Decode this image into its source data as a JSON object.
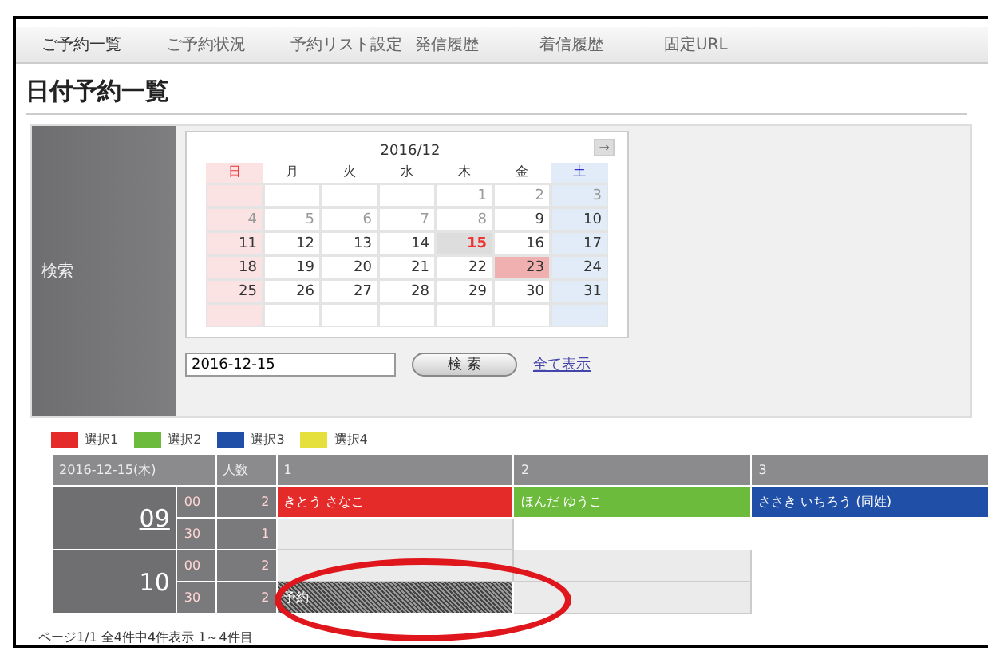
{
  "nav": [
    {
      "label": "ご予約一覧",
      "selected": true
    },
    {
      "label": "ご予約状況",
      "selected": false
    },
    {
      "label": "予約リスト設定",
      "selected": false
    },
    {
      "label": "発信履歴",
      "selected": false
    },
    {
      "label": "着信履歴",
      "selected": false
    },
    {
      "label": "固定URL",
      "selected": false
    }
  ],
  "page_title": "日付予約一覧",
  "search": {
    "label": "検索",
    "calendar": {
      "month": "2016/12",
      "next": "→",
      "weekdays": [
        "日",
        "月",
        "火",
        "水",
        "木",
        "金",
        "土"
      ],
      "cells": [
        {
          "kind": "empty"
        },
        {
          "kind": "empty"
        },
        {
          "kind": "empty"
        },
        {
          "kind": "empty"
        },
        {
          "kind": "day",
          "day": "1",
          "disabled": true,
          "today": false,
          "selected": false
        },
        {
          "kind": "day",
          "day": "2",
          "disabled": true,
          "today": false,
          "selected": false
        },
        {
          "kind": "day",
          "day": "3",
          "disabled": true,
          "today": false,
          "selected": false
        },
        {
          "kind": "day",
          "day": "4",
          "disabled": true,
          "today": false,
          "selected": false
        },
        {
          "kind": "day",
          "day": "5",
          "disabled": true,
          "today": false,
          "selected": false
        },
        {
          "kind": "day",
          "day": "6",
          "disabled": true,
          "today": false,
          "selected": false
        },
        {
          "kind": "day",
          "day": "7",
          "disabled": true,
          "today": false,
          "selected": false
        },
        {
          "kind": "day",
          "day": "8",
          "disabled": true,
          "today": false,
          "selected": false
        },
        {
          "kind": "day",
          "day": "9",
          "disabled": false,
          "today": false,
          "selected": false
        },
        {
          "kind": "day",
          "day": "10",
          "disabled": false,
          "today": false,
          "selected": false
        },
        {
          "kind": "day",
          "day": "11",
          "disabled": false,
          "today": false,
          "selected": false
        },
        {
          "kind": "day",
          "day": "12",
          "disabled": false,
          "today": false,
          "selected": false
        },
        {
          "kind": "day",
          "day": "13",
          "disabled": false,
          "today": false,
          "selected": false
        },
        {
          "kind": "day",
          "day": "14",
          "disabled": false,
          "today": false,
          "selected": false
        },
        {
          "kind": "day",
          "day": "15",
          "disabled": false,
          "today": true,
          "selected": false
        },
        {
          "kind": "day",
          "day": "16",
          "disabled": false,
          "today": false,
          "selected": false
        },
        {
          "kind": "day",
          "day": "17",
          "disabled": false,
          "today": false,
          "selected": false
        },
        {
          "kind": "day",
          "day": "18",
          "disabled": false,
          "today": false,
          "selected": false
        },
        {
          "kind": "day",
          "day": "19",
          "disabled": false,
          "today": false,
          "selected": false
        },
        {
          "kind": "day",
          "day": "20",
          "disabled": false,
          "today": false,
          "selected": false
        },
        {
          "kind": "day",
          "day": "21",
          "disabled": false,
          "today": false,
          "selected": false
        },
        {
          "kind": "day",
          "day": "22",
          "disabled": false,
          "today": false,
          "selected": false
        },
        {
          "kind": "day",
          "day": "23",
          "disabled": false,
          "today": false,
          "selected": true
        },
        {
          "kind": "day",
          "day": "24",
          "disabled": false,
          "today": false,
          "selected": false
        },
        {
          "kind": "day",
          "day": "25",
          "disabled": false,
          "today": false,
          "selected": false
        },
        {
          "kind": "day",
          "day": "26",
          "disabled": false,
          "today": false,
          "selected": false
        },
        {
          "kind": "day",
          "day": "27",
          "disabled": false,
          "today": false,
          "selected": false
        },
        {
          "kind": "day",
          "day": "28",
          "disabled": false,
          "today": false,
          "selected": false
        },
        {
          "kind": "day",
          "day": "29",
          "disabled": false,
          "today": false,
          "selected": false
        },
        {
          "kind": "day",
          "day": "30",
          "disabled": false,
          "today": false,
          "selected": false
        },
        {
          "kind": "day",
          "day": "31",
          "disabled": false,
          "today": false,
          "selected": false
        },
        {
          "kind": "empty"
        },
        {
          "kind": "empty"
        },
        {
          "kind": "empty"
        },
        {
          "kind": "empty"
        },
        {
          "kind": "empty"
        },
        {
          "kind": "empty"
        },
        {
          "kind": "empty"
        }
      ]
    },
    "date_value": "2016-12-15",
    "button": "検 索",
    "show_all": "全て表示"
  },
  "legend": [
    {
      "label": "選択1",
      "color": "#e52a2a"
    },
    {
      "label": "選択2",
      "color": "#6cbb3c"
    },
    {
      "label": "選択3",
      "color": "#1f4fa6"
    },
    {
      "label": "選択4",
      "color": "#e6e03c"
    }
  ],
  "schedule": {
    "date": "2016-12-15(木)",
    "count_header": "人数",
    "columns": [
      "1",
      "2",
      "3"
    ],
    "hours": [
      {
        "hour": "09",
        "slots": [
          {
            "minute": "00",
            "count": "2",
            "cells": [
              {
                "kind": "booked",
                "text": "きとう さなこ",
                "color": "#e52a2a"
              },
              {
                "kind": "booked",
                "text": "ほんだ ゆうこ",
                "color": "#6cbb3c"
              },
              {
                "kind": "booked",
                "text": "ささき いちろう (同姓)",
                "color": "#1f4fa6"
              }
            ]
          },
          {
            "minute": "30",
            "count": "1",
            "cells": [
              {
                "kind": "open"
              },
              {
                "kind": "blank"
              },
              {
                "kind": "blank"
              }
            ]
          }
        ]
      },
      {
        "hour": "10",
        "slots": [
          {
            "minute": "00",
            "count": "2",
            "cells": [
              {
                "kind": "open"
              },
              {
                "kind": "open"
              },
              {
                "kind": "blank"
              }
            ]
          },
          {
            "minute": "30",
            "count": "2",
            "cells": [
              {
                "kind": "hatched",
                "text": "予約"
              },
              {
                "kind": "open"
              },
              {
                "kind": "blank"
              }
            ]
          }
        ]
      }
    ]
  },
  "footer": "ページ1/1 全4件中4件表示 1～4件目"
}
